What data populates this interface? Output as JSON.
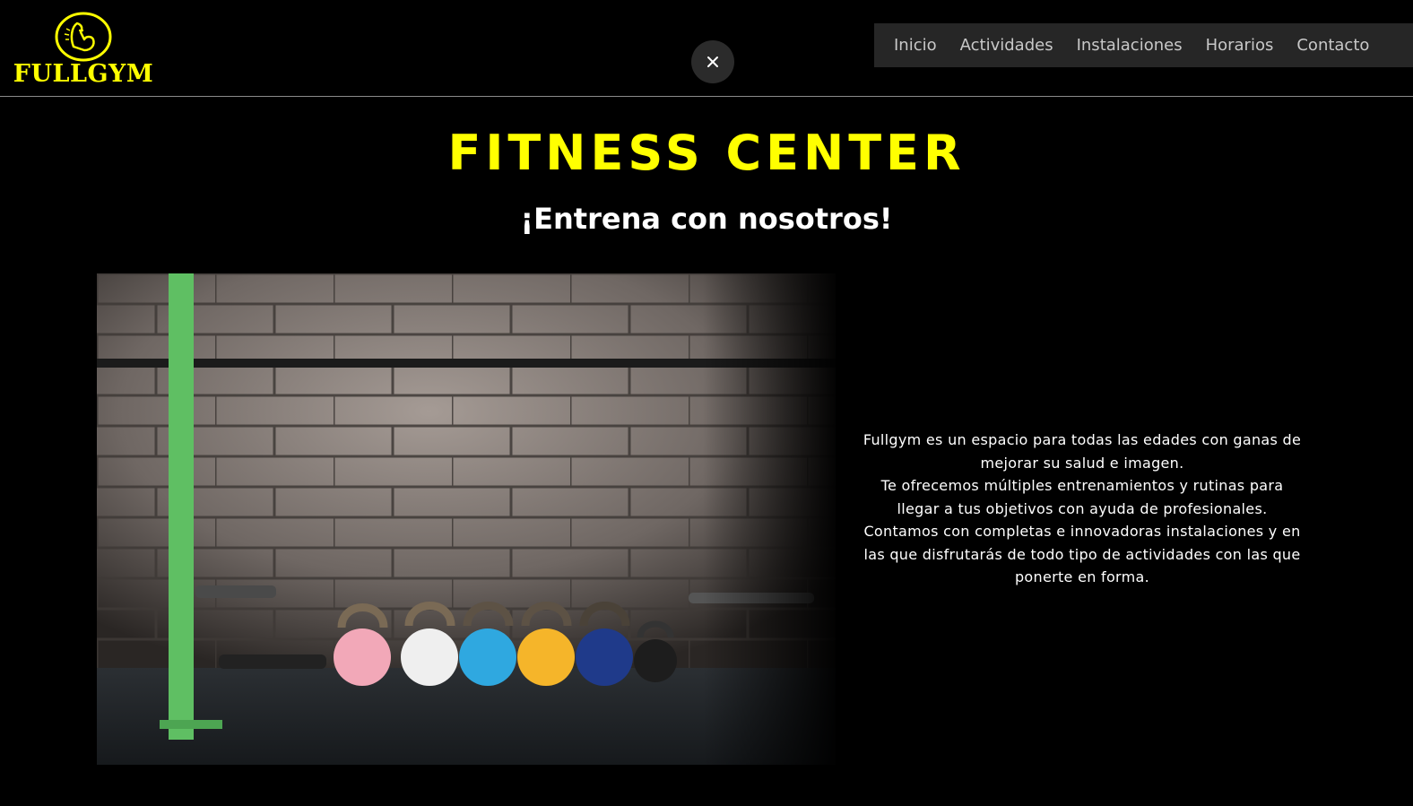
{
  "brand": {
    "name": "FULLGYM",
    "accent_color": "#ffff00"
  },
  "nav": {
    "items": [
      {
        "label": "Inicio"
      },
      {
        "label": "Actividades"
      },
      {
        "label": "Instalaciones"
      },
      {
        "label": "Horarios"
      },
      {
        "label": "Contacto"
      }
    ]
  },
  "close_button": {
    "icon": "close-icon"
  },
  "hero": {
    "title": "FITNESS CENTER",
    "subtitle": "¡Entrena con nosotros!"
  },
  "photo": {
    "subject": "kettlebells-against-brick-wall"
  },
  "description": {
    "paragraphs": [
      "Fullgym es un espacio para todas las edades con ganas de mejorar su salud e imagen.",
      "Te ofrecemos múltiples entrenamientos y rutinas para llegar a tus objetivos con ayuda de profesionales.",
      "Contamos con completas e innovadoras instalaciones y en las que disfrutarás de todo tipo de actividades con las que ponerte en forma."
    ]
  }
}
